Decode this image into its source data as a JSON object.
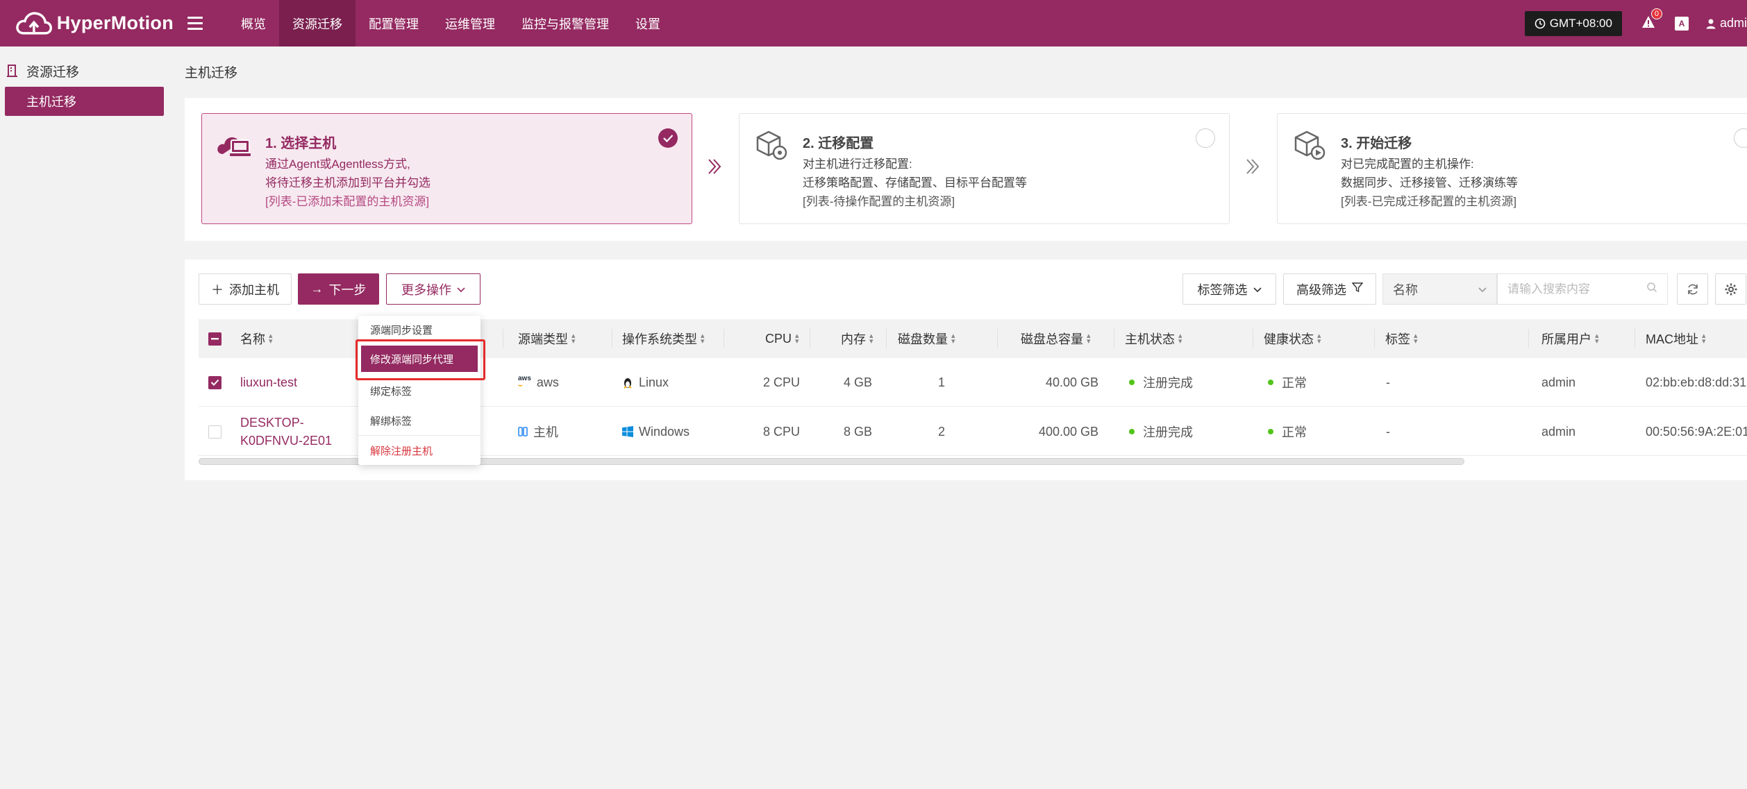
{
  "app": {
    "name": "HyperMotion",
    "nav": [
      "概览",
      "资源迁移",
      "配置管理",
      "运维管理",
      "监控与报警管理",
      "设置"
    ],
    "active_nav": "资源迁移",
    "timezone": "GMT+08:00",
    "alert_count": "0",
    "lang_icon": "A",
    "user": "admin"
  },
  "sidebar": {
    "group": "资源迁移",
    "items": [
      {
        "label": "主机迁移",
        "active": true
      }
    ]
  },
  "page": {
    "title": "主机迁移"
  },
  "steps": [
    {
      "title": "1. 选择主机",
      "lines": [
        "通过Agent或Agentless方式,",
        "将待迁移主机添加到平台并勾选"
      ],
      "note": "[列表-已添加未配置的主机资源]",
      "done": true
    },
    {
      "title": "2. 迁移配置",
      "lines": [
        "对主机进行迁移配置:",
        "迁移策略配置、存储配置、目标平台配置等"
      ],
      "note": "[列表-待操作配置的主机资源]",
      "done": false
    },
    {
      "title": "3. 开始迁移",
      "lines": [
        "对已完成配置的主机操作:",
        "数据同步、迁移接管、迁移演练等"
      ],
      "note": "[列表-已完成迁移配置的主机资源]",
      "done": false
    }
  ],
  "toolbar": {
    "add_host": "添加主机",
    "next_step": "下一步",
    "more_actions": "更多操作",
    "tag_filter": "标签筛选",
    "advanced_filter": "高级筛选",
    "search_field": "名称",
    "search_placeholder": "请输入搜索内容"
  },
  "table": {
    "columns": [
      "名称",
      "源端类型",
      "操作系统类型",
      "CPU",
      "内存",
      "磁盘数量",
      "磁盘总容量",
      "主机状态",
      "健康状态",
      "标签",
      "所属用户",
      "MAC地址"
    ],
    "rows": [
      {
        "checked": true,
        "name": "liuxun-test",
        "source_type": "aws",
        "os": "Linux",
        "cpu": "2 CPU",
        "memory": "4 GB",
        "disk_count": "1",
        "disk_total": "40.00 GB",
        "host_status": "注册完成",
        "health": "正常",
        "tags": "-",
        "owner": "admin",
        "mac": "02:bb:eb:d8:dd:31"
      },
      {
        "checked": false,
        "name_line1": "DESKTOP-",
        "name_line2": "K0DFNVU-2E01",
        "source_type": "主机",
        "os": "Windows",
        "cpu": "8 CPU",
        "memory": "8 GB",
        "disk_count": "2",
        "disk_total": "400.00 GB",
        "host_status": "注册完成",
        "health": "正常",
        "tags": "-",
        "owner": "admin",
        "mac": "00:50:56:9A:2E:01"
      }
    ]
  },
  "dropdown_menu": {
    "items": [
      "源端同步设置",
      "修改源端同步代理",
      "绑定标签",
      "解绑标签",
      "解除注册主机"
    ],
    "highlighted": "修改源端同步代理"
  },
  "colors": {
    "brand": "#942a61",
    "status_ok": "#52c41a",
    "danger": "#d9363e",
    "highlight_box": "#e52b2b"
  }
}
